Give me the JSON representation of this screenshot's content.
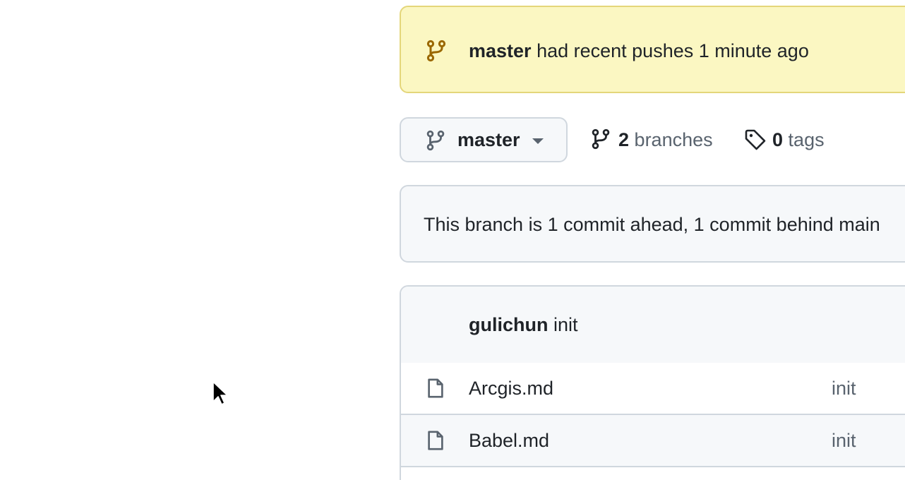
{
  "banner": {
    "branch": "master",
    "message": " had recent pushes 1 minute ago",
    "icon": "git-branch-icon",
    "accent": "#9a6700"
  },
  "branch_controls": {
    "current_branch": "master",
    "branches_count": "2",
    "branches_label": "branches",
    "tags_count": "0",
    "tags_label": "tags"
  },
  "compare": {
    "text": "This branch is 1 commit ahead, 1 commit behind main"
  },
  "latest_commit": {
    "author": "gulichun",
    "message": " init"
  },
  "files": [
    {
      "name": "Arcgis.md",
      "message": "init",
      "icon": "file-icon"
    },
    {
      "name": "Babel.md",
      "message": "init",
      "icon": "file-icon"
    }
  ],
  "colors": {
    "banner_bg": "#fbf7c2",
    "border": "#d0d7de",
    "muted": "#59636e"
  }
}
